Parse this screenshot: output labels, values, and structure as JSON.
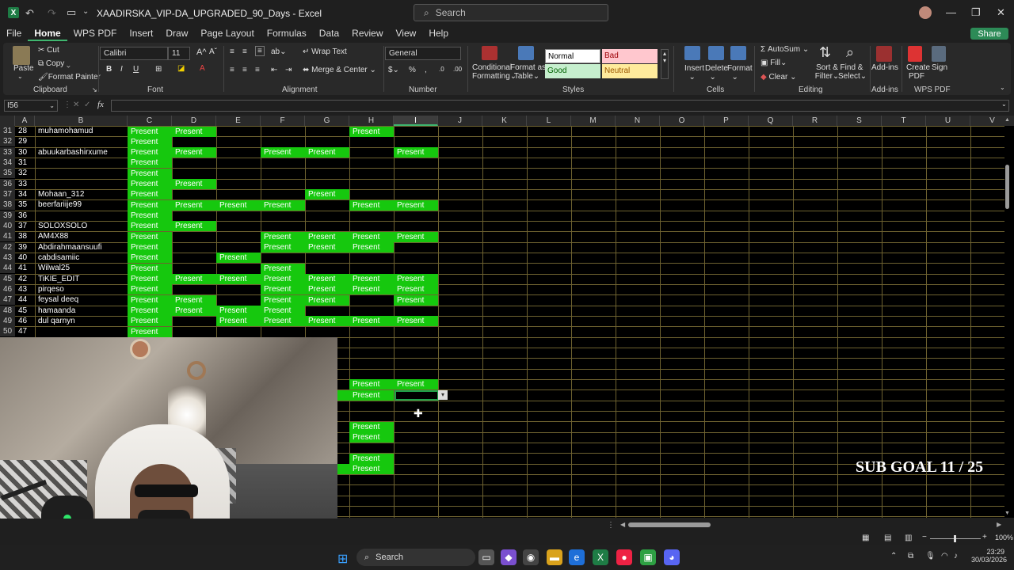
{
  "titlebar": {
    "doc_title": "XAADIRSKA_VIP-DA_UPGRADED_90_Days  -  Excel",
    "search_placeholder": "Search"
  },
  "menu": [
    "File",
    "Home",
    "WPS PDF",
    "Insert",
    "Draw",
    "Page Layout",
    "Formulas",
    "Data",
    "Review",
    "View",
    "Help"
  ],
  "share_label": "Share",
  "ribbon": {
    "paste": "Paste",
    "cut": "Cut",
    "copy": "Copy",
    "format_painter": "Format Painter",
    "clipboard": "Clipboard",
    "font_name": "Calibri",
    "font_size": "11",
    "font": "Font",
    "wrap_text": "Wrap Text",
    "merge_center": "Merge & Center",
    "alignment": "Alignment",
    "number_format": "General",
    "number": "Number",
    "conditional": "Conditional",
    "formatting": "Formatting",
    "format_as": "Format as",
    "table": "Table",
    "style_normal": "Normal",
    "style_bad": "Bad",
    "style_good": "Good",
    "style_neutral": "Neutral",
    "styles": "Styles",
    "insert": "Insert",
    "delete": "Delete",
    "format": "Format",
    "cells": "Cells",
    "autosum": "AutoSum",
    "fill": "Fill",
    "clear": "Clear",
    "sort_filter_1": "Sort &",
    "sort_filter_2": "Filter",
    "find_select_1": "Find &",
    "find_select_2": "Select",
    "editing": "Editing",
    "addins": "Add-ins",
    "addins_group": "Add-ins",
    "create_pdf_1": "Create",
    "create_pdf_2": "PDF",
    "sign": "Sign",
    "wps_pdf": "WPS PDF"
  },
  "namebox": "I56",
  "fx": "fx",
  "columns": [
    "A",
    "B",
    "C",
    "D",
    "E",
    "F",
    "G",
    "H",
    "I",
    "J",
    "K",
    "L",
    "M",
    "N",
    "O",
    "P",
    "Q",
    "R",
    "S",
    "T",
    "U",
    "V"
  ],
  "selected_column": "I",
  "present_label": "Present",
  "rows": [
    {
      "row": "31",
      "a": "28",
      "b": "muhamohamud",
      "present": [
        "C",
        "D",
        "H"
      ]
    },
    {
      "row": "32",
      "a": "29",
      "b": "",
      "present": [
        "C"
      ]
    },
    {
      "row": "33",
      "a": "30",
      "b": "abuukarbashirxume",
      "present": [
        "C",
        "D",
        "F",
        "G",
        "I"
      ]
    },
    {
      "row": "34",
      "a": "31",
      "b": "",
      "present": [
        "C"
      ]
    },
    {
      "row": "35",
      "a": "32",
      "b": "",
      "present": [
        "C"
      ]
    },
    {
      "row": "36",
      "a": "33",
      "b": "",
      "present": [
        "C",
        "D"
      ]
    },
    {
      "row": "37",
      "a": "34",
      "b": "Mohaan_312",
      "present": [
        "C",
        "G"
      ]
    },
    {
      "row": "38",
      "a": "35",
      "b": "beerfariije99",
      "present": [
        "C",
        "D",
        "E",
        "F",
        "H",
        "I"
      ]
    },
    {
      "row": "39",
      "a": "36",
      "b": "",
      "present": [
        "C"
      ]
    },
    {
      "row": "40",
      "a": "37",
      "b": "SOLOXSOLO",
      "present": [
        "C",
        "D"
      ]
    },
    {
      "row": "41",
      "a": "38",
      "b": "AM4X88",
      "present": [
        "C",
        "F",
        "G",
        "H",
        "I"
      ]
    },
    {
      "row": "42",
      "a": "39",
      "b": "Abdirahmaansuufi",
      "present": [
        "C",
        "F",
        "G",
        "H"
      ]
    },
    {
      "row": "43",
      "a": "40",
      "b": "cabdisamiic",
      "present": [
        "C",
        "E"
      ]
    },
    {
      "row": "44",
      "a": "41",
      "b": "Wilwal25",
      "present": [
        "C",
        "F"
      ]
    },
    {
      "row": "45",
      "a": "42",
      "b": "TiKIE_EDIT",
      "present": [
        "C",
        "D",
        "E",
        "F",
        "G",
        "H",
        "I"
      ]
    },
    {
      "row": "46",
      "a": "43",
      "b": "pirqeso",
      "present": [
        "C",
        "F",
        "G",
        "H",
        "I"
      ]
    },
    {
      "row": "47",
      "a": "44",
      "b": "feysal deeq",
      "present": [
        "C",
        "D",
        "F",
        "G",
        "I"
      ]
    },
    {
      "row": "48",
      "a": "45",
      "b": "hamaanda",
      "present": [
        "C",
        "D",
        "E",
        "F"
      ]
    },
    {
      "row": "49",
      "a": "46",
      "b": "dul qarnyn",
      "present": [
        "C",
        "E",
        "F",
        "G",
        "H",
        "I"
      ]
    },
    {
      "row": "50",
      "a": "47",
      "b": "",
      "present": [
        "C"
      ]
    }
  ],
  "lower_present": [
    {
      "col": "H",
      "r": 0
    },
    {
      "col": "I",
      "r": 0
    },
    {
      "col": "H",
      "r": 1
    },
    {
      "col": "H",
      "r": 4
    },
    {
      "col": "H",
      "r": 5
    },
    {
      "col": "H",
      "r": 7
    },
    {
      "col": "H",
      "r": 8
    }
  ],
  "overlay_text": "SUB GOAL 11 / 25",
  "status": {
    "zoom": "100%"
  },
  "taskbar": {
    "search": "Search",
    "time": "23:29",
    "date": "30/03/2026"
  }
}
